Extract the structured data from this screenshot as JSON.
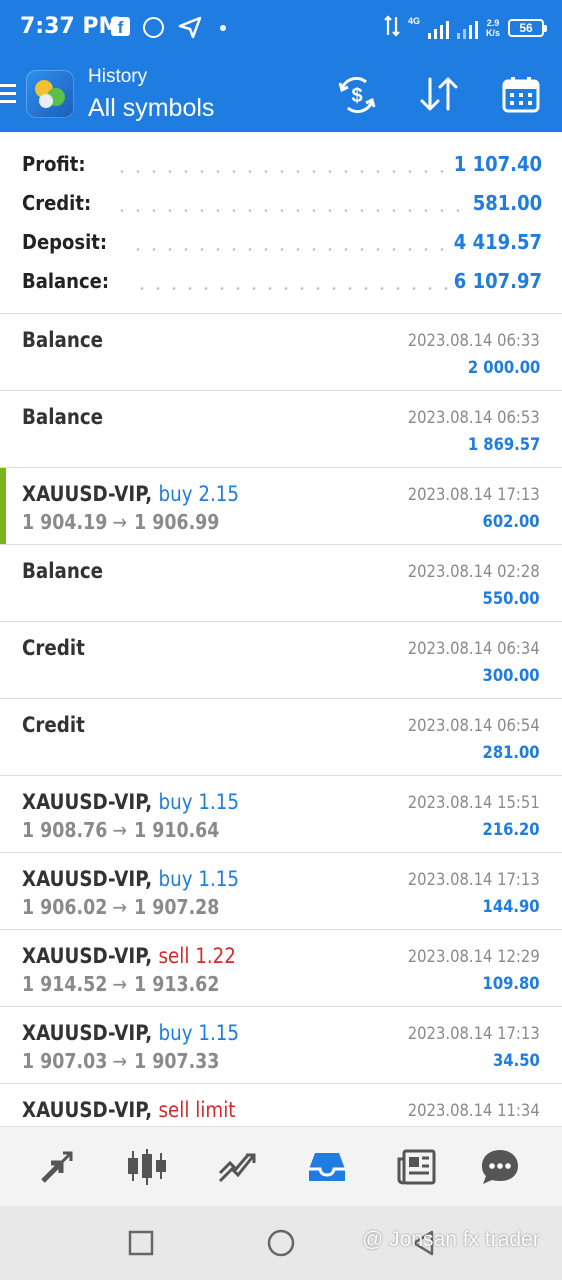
{
  "status_bar": {
    "time": "7:37 PM",
    "icons": [
      "facebook-icon",
      "whatsapp-icon",
      "send-icon",
      "dot-icon"
    ],
    "network": "4G",
    "speed_value": "2.9",
    "speed_unit": "K/s",
    "battery": "56"
  },
  "app_bar": {
    "subtitle": "History",
    "title": "All symbols",
    "actions": [
      "currency-exchange-icon",
      "sort-icon",
      "calendar-icon"
    ]
  },
  "summary": [
    {
      "label": "Profit:",
      "value": "1 107.40"
    },
    {
      "label": "Credit:",
      "value": "581.00"
    },
    {
      "label": "Deposit:",
      "value": "4 419.57"
    },
    {
      "label": "Balance:",
      "value": "6 107.97"
    }
  ],
  "deals": [
    {
      "symbol": "Balance",
      "type": "",
      "side": "",
      "open": "",
      "arrow": "",
      "close": "",
      "time": "2023.08.14 06:33",
      "amount": "2 000.00",
      "marked": false
    },
    {
      "symbol": "Balance",
      "type": "",
      "side": "",
      "open": "",
      "arrow": "",
      "close": "",
      "time": "2023.08.14 06:53",
      "amount": "1 869.57",
      "marked": false
    },
    {
      "symbol": "XAUUSD-VIP,",
      "type": "buy 2.15",
      "side": "buy",
      "open": "1 904.19",
      "arrow": "→",
      "close": "1 906.99",
      "time": "2023.08.14 17:13",
      "amount": "602.00",
      "marked": true
    },
    {
      "symbol": "Balance",
      "type": "",
      "side": "",
      "open": "",
      "arrow": "",
      "close": "",
      "time": "2023.08.14 02:28",
      "amount": "550.00",
      "marked": false
    },
    {
      "symbol": "Credit",
      "type": "",
      "side": "",
      "open": "",
      "arrow": "",
      "close": "",
      "time": "2023.08.14 06:34",
      "amount": "300.00",
      "marked": false
    },
    {
      "symbol": "Credit",
      "type": "",
      "side": "",
      "open": "",
      "arrow": "",
      "close": "",
      "time": "2023.08.14 06:54",
      "amount": "281.00",
      "marked": false
    },
    {
      "symbol": "XAUUSD-VIP,",
      "type": "buy 1.15",
      "side": "buy",
      "open": "1 908.76",
      "arrow": "→",
      "close": "1 910.64",
      "time": "2023.08.14 15:51",
      "amount": "216.20",
      "marked": false
    },
    {
      "symbol": "XAUUSD-VIP,",
      "type": "buy 1.15",
      "side": "buy",
      "open": "1 906.02",
      "arrow": "→",
      "close": "1 907.28",
      "time": "2023.08.14 17:13",
      "amount": "144.90",
      "marked": false
    },
    {
      "symbol": "XAUUSD-VIP,",
      "type": "sell 1.22",
      "side": "sell",
      "open": "1 914.52",
      "arrow": "→",
      "close": "1 913.62",
      "time": "2023.08.14 12:29",
      "amount": "109.80",
      "marked": false
    },
    {
      "symbol": "XAUUSD-VIP,",
      "type": "buy 1.15",
      "side": "buy",
      "open": "1 907.03",
      "arrow": "→",
      "close": "1 907.33",
      "time": "2023.08.14 17:13",
      "amount": "34.50",
      "marked": false
    },
    {
      "symbol": "XAUUSD-VIP,",
      "type": "sell limit",
      "side": "sell",
      "open": "",
      "arrow": "",
      "close": "",
      "time": "2023.08.14 11:34",
      "amount": "",
      "marked": false
    }
  ],
  "bottom_nav": {
    "items": [
      "quotes-icon",
      "chart-icon",
      "trade-icon",
      "history-icon",
      "news-icon",
      "messages-icon"
    ],
    "active": "history-icon",
    "active_color": "#1f7ce0"
  },
  "system_nav": {
    "items": [
      "recents-button",
      "home-button",
      "back-button"
    ],
    "watermark": "@ Jonsan fx trader"
  },
  "colors": {
    "primary": "#1f7ce0",
    "buy": "#1f7ce0",
    "sell": "#d42a2a",
    "marker": "#7ab51d"
  }
}
